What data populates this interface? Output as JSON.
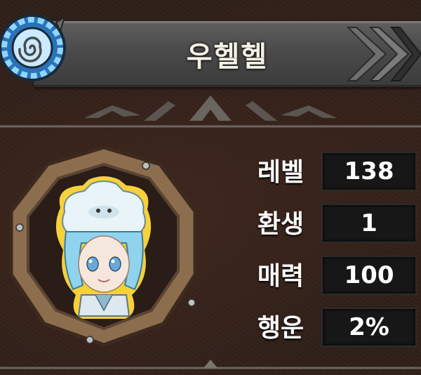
{
  "character": {
    "name": "우헬헬"
  },
  "stats": [
    {
      "label": "레벨",
      "value": "138"
    },
    {
      "label": "환생",
      "value": "1"
    },
    {
      "label": "매력",
      "value": "100"
    },
    {
      "label": "행운",
      "value": "2%"
    }
  ],
  "icons": {
    "emblem": "spiral-emblem-icon",
    "banner_arrows": "double-chevron-icon"
  },
  "colors": {
    "background": "#2f2019",
    "banner": "#4a4a4a",
    "emblem": "#3fa6e6",
    "frame": "#8c6d4e",
    "value_box": "#171717"
  }
}
